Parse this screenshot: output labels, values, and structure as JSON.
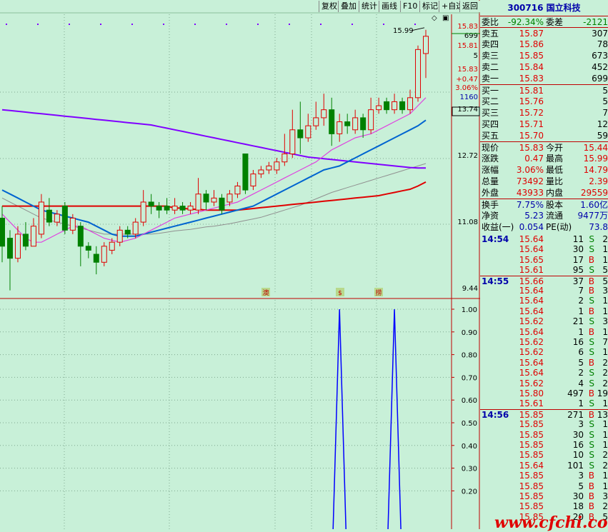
{
  "toolbar": {
    "buttons": [
      "复权",
      "叠加",
      "统计",
      "画线",
      "F10",
      "标记",
      "+自选",
      "返回"
    ]
  },
  "price_axis": {
    "labels": [
      "15.83",
      "699",
      "15.81",
      "5",
      "15.83",
      "+0.47",
      "3.06%",
      "1160",
      "13.74",
      "12.72",
      "11.08",
      "9.44"
    ],
    "high_label": "15.99"
  },
  "indicator_axis": {
    "labels": [
      "1.00",
      "0.90",
      "0.80",
      "0.70",
      "0.60",
      "0.50",
      "0.40",
      "0.30",
      "0.20"
    ]
  },
  "markers": [
    "澳",
    "$",
    "捞"
  ],
  "colors": {
    "background": "#c8f0d8",
    "up": "#e00000",
    "down": "#008000",
    "ma_purple": "#8000ff",
    "ma_red": "#e00000",
    "ma_blue": "#0064d0",
    "ma_magenta": "#e040e0"
  },
  "quote": {
    "code": "300716",
    "name": "国立科技",
    "weibi_label": "委比",
    "weibi": "-92.34%",
    "weicha_label": "委差",
    "weicha": "-2121",
    "asks": [
      {
        "label": "卖五",
        "price": "15.87",
        "vol": "307"
      },
      {
        "label": "卖四",
        "price": "15.86",
        "vol": "78"
      },
      {
        "label": "卖三",
        "price": "15.85",
        "vol": "673"
      },
      {
        "label": "卖二",
        "price": "15.84",
        "vol": "452"
      },
      {
        "label": "卖一",
        "price": "15.83",
        "vol": "699"
      }
    ],
    "bids": [
      {
        "label": "买一",
        "price": "15.81",
        "vol": "5"
      },
      {
        "label": "买二",
        "price": "15.76",
        "vol": "5"
      },
      {
        "label": "买三",
        "price": "15.72",
        "vol": "7"
      },
      {
        "label": "买四",
        "price": "15.71",
        "vol": "12"
      },
      {
        "label": "买五",
        "price": "15.70",
        "vol": "59"
      }
    ],
    "stats": [
      {
        "l1": "现价",
        "v1": "15.83",
        "l2": "今开",
        "v2": "15.44"
      },
      {
        "l1": "涨跌",
        "v1": "0.47",
        "l2": "最高",
        "v2": "15.99"
      },
      {
        "l1": "涨幅",
        "v1": "3.06%",
        "l2": "最低",
        "v2": "14.79"
      },
      {
        "l1": "总量",
        "v1": "73492",
        "l2": "量比",
        "v2": "2.39"
      },
      {
        "l1": "外盘",
        "v1": "43933",
        "l2": "内盘",
        "v2": "29559"
      }
    ],
    "stats2": [
      {
        "l1": "换手",
        "v1": "7.75%",
        "l2": "股本",
        "v2": "1.60亿"
      },
      {
        "l1": "净资",
        "v1": "5.23",
        "l2": "流通",
        "v2": "9477万"
      },
      {
        "l1": "收益(一)",
        "v1": "0.054",
        "l2": "PE(动)",
        "v2": "73.8"
      }
    ]
  },
  "ticks": [
    {
      "time": "14:54",
      "price": "15.64",
      "vol": "11",
      "bs": "S",
      "n": "2"
    },
    {
      "time": "",
      "price": "15.64",
      "vol": "30",
      "bs": "S",
      "n": "1"
    },
    {
      "time": "",
      "price": "15.65",
      "vol": "17",
      "bs": "B",
      "n": "1"
    },
    {
      "time": "",
      "price": "15.61",
      "vol": "95",
      "bs": "S",
      "n": "5"
    },
    {
      "time": "14:55",
      "price": "15.66",
      "vol": "37",
      "bs": "B",
      "n": "5"
    },
    {
      "time": "",
      "price": "15.64",
      "vol": "7",
      "bs": "B",
      "n": "3"
    },
    {
      "time": "",
      "price": "15.64",
      "vol": "2",
      "bs": "S",
      "n": "1"
    },
    {
      "time": "",
      "price": "15.64",
      "vol": "1",
      "bs": "B",
      "n": "1"
    },
    {
      "time": "",
      "price": "15.62",
      "vol": "21",
      "bs": "S",
      "n": "3"
    },
    {
      "time": "",
      "price": "15.64",
      "vol": "1",
      "bs": "B",
      "n": "1"
    },
    {
      "time": "",
      "price": "15.62",
      "vol": "16",
      "bs": "S",
      "n": "7"
    },
    {
      "time": "",
      "price": "15.62",
      "vol": "6",
      "bs": "S",
      "n": "1"
    },
    {
      "time": "",
      "price": "15.64",
      "vol": "5",
      "bs": "B",
      "n": "2"
    },
    {
      "time": "",
      "price": "15.64",
      "vol": "2",
      "bs": "S",
      "n": "2"
    },
    {
      "time": "",
      "price": "15.62",
      "vol": "4",
      "bs": "S",
      "n": "2"
    },
    {
      "time": "",
      "price": "15.80",
      "vol": "497",
      "bs": "B",
      "n": "19"
    },
    {
      "time": "",
      "price": "15.61",
      "vol": "1",
      "bs": "S",
      "n": "1"
    },
    {
      "time": "14:56",
      "price": "15.85",
      "vol": "271",
      "bs": "B",
      "n": "13"
    },
    {
      "time": "",
      "price": "15.85",
      "vol": "3",
      "bs": "S",
      "n": "1"
    },
    {
      "time": "",
      "price": "15.85",
      "vol": "30",
      "bs": "S",
      "n": "1"
    },
    {
      "time": "",
      "price": "15.85",
      "vol": "16",
      "bs": "S",
      "n": "1"
    },
    {
      "time": "",
      "price": "15.85",
      "vol": "10",
      "bs": "S",
      "n": "2"
    },
    {
      "time": "",
      "price": "15.64",
      "vol": "101",
      "bs": "S",
      "n": "2"
    },
    {
      "time": "",
      "price": "15.85",
      "vol": "3",
      "bs": "B",
      "n": "1"
    },
    {
      "time": "",
      "price": "15.85",
      "vol": "5",
      "bs": "B",
      "n": "1"
    },
    {
      "time": "",
      "price": "15.85",
      "vol": "30",
      "bs": "B",
      "n": "3"
    },
    {
      "time": "",
      "price": "15.85",
      "vol": "18",
      "bs": "B",
      "n": "2"
    },
    {
      "time": "",
      "price": "15.85",
      "vol": "20",
      "bs": "B",
      "n": "5"
    }
  ],
  "watermark": "www.cfchi.com",
  "chart_data": {
    "type": "candlestick",
    "ylim": [
      9.44,
      16.2
    ],
    "candles": [
      {
        "o": 11.3,
        "c": 10.6,
        "h": 11.6,
        "l": 10.2
      },
      {
        "o": 10.8,
        "c": 10.3,
        "h": 11.0,
        "l": 9.5
      },
      {
        "o": 10.3,
        "c": 10.9,
        "h": 11.1,
        "l": 10.2
      },
      {
        "o": 10.9,
        "c": 10.6,
        "h": 11.2,
        "l": 10.5
      },
      {
        "o": 10.6,
        "c": 11.1,
        "h": 11.3,
        "l": 10.6
      },
      {
        "o": 10.9,
        "c": 11.7,
        "h": 11.9,
        "l": 10.8
      },
      {
        "o": 11.5,
        "c": 11.2,
        "h": 11.8,
        "l": 11.1
      },
      {
        "o": 11.2,
        "c": 11.4,
        "h": 11.5,
        "l": 11.1
      },
      {
        "o": 11.6,
        "c": 11.0,
        "h": 11.7,
        "l": 10.9
      },
      {
        "o": 11.0,
        "c": 11.3,
        "h": 11.4,
        "l": 10.9
      },
      {
        "o": 11.1,
        "c": 10.6,
        "h": 11.2,
        "l": 10.1
      },
      {
        "o": 10.6,
        "c": 10.5,
        "h": 10.7,
        "l": 10.3
      },
      {
        "o": 10.4,
        "c": 10.2,
        "h": 10.6,
        "l": 9.9
      },
      {
        "o": 10.2,
        "c": 10.6,
        "h": 10.7,
        "l": 10.1
      },
      {
        "o": 10.5,
        "c": 10.7,
        "h": 10.8,
        "l": 10.4
      },
      {
        "o": 10.7,
        "c": 11.0,
        "h": 11.1,
        "l": 10.6
      },
      {
        "o": 11.0,
        "c": 10.9,
        "h": 11.1,
        "l": 10.8
      },
      {
        "o": 10.9,
        "c": 11.2,
        "h": 11.3,
        "l": 10.8
      },
      {
        "o": 11.2,
        "c": 11.7,
        "h": 12.0,
        "l": 11.1
      },
      {
        "o": 11.7,
        "c": 11.6,
        "h": 11.9,
        "l": 11.4
      },
      {
        "o": 11.6,
        "c": 11.5,
        "h": 11.7,
        "l": 11.3
      },
      {
        "o": 11.6,
        "c": 11.5,
        "h": 11.8,
        "l": 11.4
      },
      {
        "o": 11.5,
        "c": 11.6,
        "h": 11.8,
        "l": 11.4
      },
      {
        "o": 11.6,
        "c": 11.5,
        "h": 11.7,
        "l": 11.4
      },
      {
        "o": 11.5,
        "c": 11.6,
        "h": 11.7,
        "l": 11.4
      },
      {
        "o": 11.5,
        "c": 11.9,
        "h": 12.3,
        "l": 11.4
      },
      {
        "o": 11.9,
        "c": 11.7,
        "h": 12.0,
        "l": 11.5
      },
      {
        "o": 11.7,
        "c": 11.8,
        "h": 12.0,
        "l": 11.6
      },
      {
        "o": 11.8,
        "c": 11.5,
        "h": 11.9,
        "l": 11.4
      },
      {
        "o": 11.7,
        "c": 11.9,
        "h": 12.0,
        "l": 11.6
      },
      {
        "o": 11.9,
        "c": 12.1,
        "h": 12.2,
        "l": 11.8
      },
      {
        "o": 12.9,
        "c": 12.0,
        "h": 12.9,
        "l": 11.9
      },
      {
        "o": 12.1,
        "c": 12.4,
        "h": 12.5,
        "l": 12.0
      },
      {
        "o": 12.4,
        "c": 12.5,
        "h": 12.6,
        "l": 12.3
      },
      {
        "o": 12.5,
        "c": 12.6,
        "h": 12.7,
        "l": 12.4
      },
      {
        "o": 12.5,
        "c": 12.7,
        "h": 12.8,
        "l": 12.4
      },
      {
        "o": 12.7,
        "c": 12.9,
        "h": 13.4,
        "l": 12.6
      },
      {
        "o": 12.9,
        "c": 13.5,
        "h": 14.0,
        "l": 12.8
      },
      {
        "o": 13.5,
        "c": 13.3,
        "h": 14.2,
        "l": 12.9
      },
      {
        "o": 13.3,
        "c": 13.6,
        "h": 13.9,
        "l": 13.2
      },
      {
        "o": 13.6,
        "c": 13.8,
        "h": 14.2,
        "l": 13.5
      },
      {
        "o": 13.8,
        "c": 14.0,
        "h": 14.4,
        "l": 13.6
      },
      {
        "o": 14.0,
        "c": 13.4,
        "h": 14.3,
        "l": 13.1
      },
      {
        "o": 13.4,
        "c": 13.7,
        "h": 13.9,
        "l": 13.2
      },
      {
        "o": 13.7,
        "c": 13.6,
        "h": 13.9,
        "l": 13.4
      },
      {
        "o": 13.5,
        "c": 13.8,
        "h": 14.0,
        "l": 13.4
      },
      {
        "o": 13.8,
        "c": 13.5,
        "h": 13.9,
        "l": 13.3
      },
      {
        "o": 13.5,
        "c": 14.0,
        "h": 14.3,
        "l": 13.4
      },
      {
        "o": 14.0,
        "c": 14.1,
        "h": 14.3,
        "l": 13.9
      },
      {
        "o": 14.2,
        "c": 14.0,
        "h": 14.3,
        "l": 13.9
      },
      {
        "o": 14.0,
        "c": 14.2,
        "h": 14.4,
        "l": 13.9
      },
      {
        "o": 14.2,
        "c": 14.0,
        "h": 14.3,
        "l": 13.9
      },
      {
        "o": 14.0,
        "c": 14.3,
        "h": 14.5,
        "l": 13.9
      },
      {
        "o": 14.3,
        "c": 15.5,
        "h": 15.6,
        "l": 14.2
      },
      {
        "o": 15.4,
        "c": 15.83,
        "h": 15.99,
        "l": 14.79
      }
    ],
    "ma_purple": [
      14.0,
      13.98,
      13.96,
      13.94,
      13.92,
      13.9,
      13.88,
      13.86,
      13.84,
      13.82,
      13.8,
      13.78,
      13.76,
      13.74,
      13.72,
      13.7,
      13.68,
      13.66,
      13.64,
      13.62,
      13.58,
      13.54,
      13.5,
      13.46,
      13.42,
      13.38,
      13.34,
      13.3,
      13.26,
      13.22,
      13.18,
      13.14,
      13.1,
      13.06,
      13.02,
      12.98,
      12.94,
      12.9,
      12.86,
      12.82,
      12.8,
      12.78,
      12.76,
      12.74,
      12.72,
      12.7,
      12.68,
      12.66,
      12.64,
      12.62,
      12.6,
      12.58,
      12.56,
      12.55,
      12.55
    ],
    "ma_red": [
      11.6,
      11.6,
      11.6,
      11.6,
      11.6,
      11.6,
      11.6,
      11.6,
      11.6,
      11.6,
      11.6,
      11.6,
      11.6,
      11.6,
      11.6,
      11.6,
      11.6,
      11.6,
      11.6,
      11.6,
      11.6,
      11.6,
      11.55,
      11.55,
      11.52,
      11.52,
      11.5,
      11.5,
      11.5,
      11.5,
      11.5,
      11.52,
      11.54,
      11.56,
      11.58,
      11.6,
      11.62,
      11.64,
      11.66,
      11.68,
      11.7,
      11.72,
      11.74,
      11.76,
      11.78,
      11.8,
      11.82,
      11.84,
      11.86,
      11.9,
      11.94,
      11.98,
      12.02,
      12.1,
      12.2
    ],
    "ma_blue": [
      12.0,
      11.9,
      11.8,
      11.7,
      11.6,
      11.5,
      11.45,
      11.4,
      11.35,
      11.3,
      11.25,
      11.2,
      11.1,
      11.0,
      10.9,
      10.85,
      10.85,
      10.85,
      10.9,
      10.95,
      11.0,
      11.05,
      11.1,
      11.15,
      11.2,
      11.25,
      11.3,
      11.35,
      11.4,
      11.45,
      11.5,
      11.55,
      11.6,
      11.7,
      11.8,
      11.9,
      12.0,
      12.1,
      12.2,
      12.3,
      12.4,
      12.5,
      12.55,
      12.6,
      12.7,
      12.8,
      12.9,
      13.0,
      13.1,
      13.2,
      13.3,
      13.4,
      13.5,
      13.6,
      13.74
    ],
    "ma_magenta": [
      11.4,
      11.2,
      11.0,
      10.8,
      10.7,
      10.7,
      10.8,
      10.9,
      11.0,
      11.1,
      11.1,
      11.0,
      10.9,
      10.8,
      10.75,
      10.7,
      10.75,
      10.8,
      10.9,
      11.0,
      11.1,
      11.2,
      11.3,
      11.35,
      11.4,
      11.45,
      11.5,
      11.55,
      11.6,
      11.65,
      11.7,
      11.8,
      11.9,
      12.0,
      12.1,
      12.2,
      12.3,
      12.4,
      12.5,
      12.6,
      12.7,
      12.85,
      13.0,
      13.1,
      13.2,
      13.3,
      13.35,
      13.4,
      13.5,
      13.6,
      13.7,
      13.8,
      13.9,
      14.1,
      14.3
    ],
    "ma_gray": [
      11.8,
      11.7,
      11.6,
      11.5,
      11.4,
      11.3,
      11.25,
      11.2,
      11.15,
      11.1,
      11.05,
      11.0,
      10.95,
      10.9,
      10.9,
      10.9,
      10.9,
      10.9,
      10.9,
      10.9,
      10.92,
      10.95,
      10.98,
      11.0,
      11.02,
      11.05,
      11.08,
      11.1,
      11.13,
      11.16,
      11.2,
      11.24,
      11.28,
      11.32,
      11.38,
      11.44,
      11.5,
      11.56,
      11.62,
      11.7,
      11.78,
      11.86,
      11.94,
      12.0,
      12.06,
      12.12,
      12.18,
      12.24,
      12.3,
      12.36,
      12.42,
      12.48,
      12.54,
      12.6,
      12.66
    ],
    "indicator": {
      "ylim": [
        0,
        1.05
      ],
      "spikes_at": [
        43,
        50
      ]
    }
  }
}
